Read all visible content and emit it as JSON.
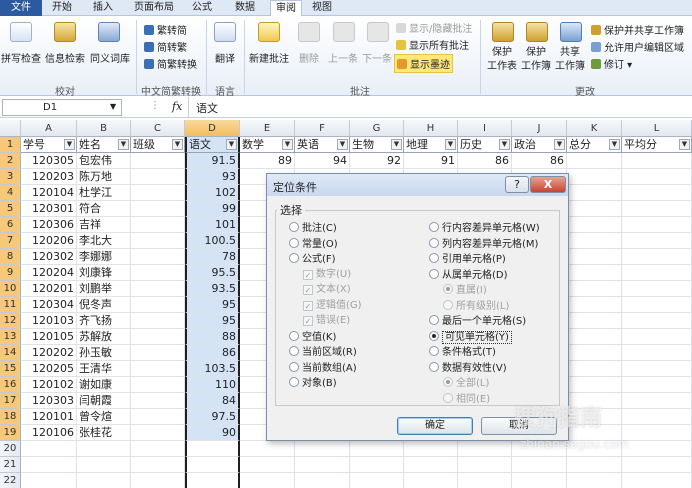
{
  "tabs": [
    "文件",
    "开始",
    "插入",
    "页面布局",
    "公式",
    "数据",
    "审阅",
    "视图"
  ],
  "ribbon": {
    "proofing": {
      "spell": "拼写检查",
      "research": "信息检索",
      "thesaurus": "同义词库",
      "label": "校对"
    },
    "chinese": {
      "to_trad": "繁转简",
      "to_simp": "简转繁",
      "convert": "简繁转换",
      "label": "中文简繁转换"
    },
    "language": {
      "translate": "翻译",
      "label": "语言"
    },
    "comments": {
      "new": "新建批注",
      "delete": "删除",
      "prev": "上一条",
      "next": "下一条",
      "show_hide": "显示/隐藏批注",
      "show_all": "显示所有批注",
      "show_ink": "显示墨迹",
      "label": "批注"
    },
    "changes": {
      "protect_sheet": "保护\n工作表",
      "protect_wb": "保护\n工作簿",
      "share_wb": "共享\n工作簿",
      "protect_share": "保护并共享工作簿",
      "allow_edit": "允许用户编辑区域",
      "track": "修订",
      "label": "更改"
    }
  },
  "formula_bar": {
    "name_box": "D1",
    "fx": "fx",
    "content": "语文"
  },
  "columns": [
    "A",
    "B",
    "C",
    "D",
    "E",
    "F",
    "G",
    "H",
    "I",
    "J",
    "K",
    "L"
  ],
  "headers": [
    "学号",
    "姓名",
    "班级",
    "语文",
    "数学",
    "英语",
    "生物",
    "地理",
    "历史",
    "政治",
    "总分",
    "平均分"
  ],
  "rows": [
    [
      "120305",
      "包宏伟",
      "",
      "91.5",
      "89",
      "94",
      "92",
      "91",
      "86",
      "86",
      "",
      ""
    ],
    [
      "120203",
      "陈万地",
      "",
      "93",
      "",
      "",
      "",
      "",
      "",
      "",
      "",
      ""
    ],
    [
      "120104",
      "杜学江",
      "",
      "102",
      "",
      "",
      "",
      "",
      "",
      "",
      "",
      ""
    ],
    [
      "120301",
      "符合",
      "",
      "99",
      "",
      "",
      "",
      "",
      "",
      "",
      "",
      ""
    ],
    [
      "120306",
      "吉祥",
      "",
      "101",
      "",
      "",
      "",
      "",
      "",
      "",
      "",
      ""
    ],
    [
      "120206",
      "李北大",
      "",
      "100.5",
      "",
      "",
      "",
      "",
      "",
      "",
      "",
      ""
    ],
    [
      "120302",
      "李娜娜",
      "",
      "78",
      "",
      "",
      "",
      "",
      "",
      "",
      "",
      ""
    ],
    [
      "120204",
      "刘康锋",
      "",
      "95.5",
      "",
      "",
      "",
      "",
      "",
      "",
      "",
      ""
    ],
    [
      "120201",
      "刘鹏举",
      "",
      "93.5",
      "",
      "",
      "",
      "",
      "",
      "",
      "",
      ""
    ],
    [
      "120304",
      "倪冬声",
      "",
      "95",
      "",
      "",
      "",
      "",
      "",
      "",
      "",
      ""
    ],
    [
      "120103",
      "齐飞扬",
      "",
      "95",
      "",
      "",
      "",
      "",
      "",
      "",
      "",
      ""
    ],
    [
      "120105",
      "苏解放",
      "",
      "88",
      "",
      "",
      "",
      "",
      "",
      "",
      "",
      ""
    ],
    [
      "120202",
      "孙玉敏",
      "",
      "86",
      "",
      "",
      "",
      "",
      "",
      "",
      "",
      ""
    ],
    [
      "120205",
      "王清华",
      "",
      "103.5",
      "",
      "",
      "",
      "",
      "",
      "",
      "",
      ""
    ],
    [
      "120102",
      "谢如康",
      "",
      "110",
      "",
      "",
      "",
      "",
      "",
      "",
      "",
      ""
    ],
    [
      "120303",
      "闫朝霞",
      "",
      "84",
      "",
      "",
      "",
      "",
      "",
      "",
      "",
      ""
    ],
    [
      "120101",
      "曾令煊",
      "",
      "97.5",
      "",
      "",
      "",
      "",
      "",
      "",
      "",
      ""
    ],
    [
      "120106",
      "张桂花",
      "",
      "90",
      "",
      "",
      "",
      "",
      "",
      "",
      "",
      ""
    ]
  ],
  "row_numbers": [
    "1",
    "2",
    "3",
    "4",
    "5",
    "6",
    "7",
    "8",
    "9",
    "10",
    "11",
    "12",
    "13",
    "14",
    "15",
    "16",
    "17",
    "18",
    "19",
    "20",
    "21",
    "22"
  ],
  "dialog": {
    "title": "定位条件",
    "help": "?",
    "close": "X",
    "group": "选择",
    "left": [
      {
        "label": "批注(C)",
        "checked": false,
        "dim": false
      },
      {
        "label": "常量(O)",
        "checked": false,
        "dim": false
      },
      {
        "label": "公式(F)",
        "checked": false,
        "dim": false
      },
      {
        "label": "数字(U)",
        "checked": true,
        "dim": true,
        "check": true
      },
      {
        "label": "文本(X)",
        "checked": true,
        "dim": true,
        "check": true
      },
      {
        "label": "逻辑值(G)",
        "checked": true,
        "dim": true,
        "check": true
      },
      {
        "label": "错误(E)",
        "checked": true,
        "dim": true,
        "check": true
      },
      {
        "label": "空值(K)",
        "checked": false,
        "dim": false
      },
      {
        "label": "当前区域(R)",
        "checked": false,
        "dim": false
      },
      {
        "label": "当前数组(A)",
        "checked": false,
        "dim": false
      },
      {
        "label": "对象(B)",
        "checked": false,
        "dim": false
      }
    ],
    "right": [
      {
        "label": "行内容差异单元格(W)",
        "checked": false,
        "dim": false
      },
      {
        "label": "列内容差异单元格(M)",
        "checked": false,
        "dim": false
      },
      {
        "label": "引用单元格(P)",
        "checked": false,
        "dim": false
      },
      {
        "label": "从属单元格(D)",
        "checked": false,
        "dim": false
      },
      {
        "label": "直属(I)",
        "checked": true,
        "dim": true,
        "indent": true
      },
      {
        "label": "所有级别(L)",
        "checked": false,
        "dim": true,
        "indent": true
      },
      {
        "label": "最后一个单元格(S)",
        "checked": false,
        "dim": false
      },
      {
        "label": "可见单元格(Y)",
        "checked": true,
        "dim": false,
        "focus": true
      },
      {
        "label": "条件格式(T)",
        "checked": false,
        "dim": false
      },
      {
        "label": "数据有效性(V)",
        "checked": false,
        "dim": false
      },
      {
        "label": "全部(L)",
        "checked": true,
        "dim": true,
        "indent": true
      },
      {
        "label": "相同(E)",
        "checked": false,
        "dim": true,
        "indent": true
      }
    ],
    "ok": "确定",
    "cancel": "取消"
  },
  "watermark": {
    "brand": "搜狗指南",
    "url": "zhinan.sogou.com"
  }
}
